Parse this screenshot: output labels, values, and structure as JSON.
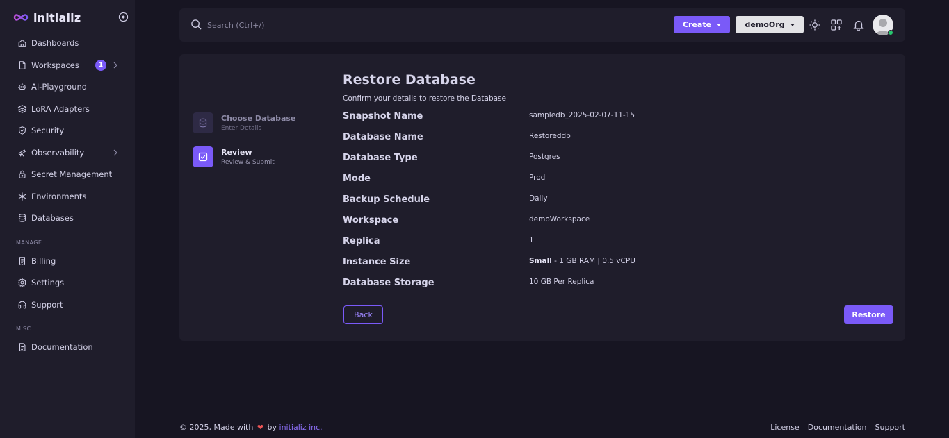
{
  "brand": {
    "name": "initializ"
  },
  "sidebar": {
    "items": [
      {
        "label": "Dashboards",
        "icon": "home-icon"
      },
      {
        "label": "Workspaces",
        "icon": "file-icon",
        "badge": "1"
      },
      {
        "label": "AI-Playground",
        "icon": "robot-icon"
      },
      {
        "label": "LoRA Adapters",
        "icon": "layers-icon"
      },
      {
        "label": "Security",
        "icon": "shield-icon"
      },
      {
        "label": "Observability",
        "icon": "telescope-icon"
      },
      {
        "label": "Secret Management",
        "icon": "lock-icon"
      },
      {
        "label": "Environments",
        "icon": "snowflake-icon"
      },
      {
        "label": "Databases",
        "icon": "database-icon"
      }
    ],
    "manage_label": "MANAGE",
    "manage_items": [
      {
        "label": "Billing",
        "icon": "receipt-icon"
      },
      {
        "label": "Settings",
        "icon": "gear-icon"
      },
      {
        "label": "Support",
        "icon": "headphones-icon"
      }
    ],
    "misc_label": "MISC",
    "misc_items": [
      {
        "label": "Documentation",
        "icon": "document-icon"
      }
    ]
  },
  "header": {
    "search_placeholder": "Search (Ctrl+/)",
    "create_label": "Create",
    "org_label": "demoOrg"
  },
  "stepper": {
    "steps": [
      {
        "title": "Choose Database",
        "subtitle": "Enter Details"
      },
      {
        "title": "Review",
        "subtitle": "Review & Submit"
      }
    ]
  },
  "review": {
    "title": "Restore Database",
    "subtitle": "Confirm your details to restore the Database",
    "rows": [
      {
        "label": "Snapshot Name",
        "value": "sampledb_2025-02-07-11-15"
      },
      {
        "label": "Database Name",
        "value": "Restoreddb"
      },
      {
        "label": "Database Type",
        "value": "Postgres"
      },
      {
        "label": "Mode",
        "value": "Prod"
      },
      {
        "label": "Backup Schedule",
        "value": "Daily"
      },
      {
        "label": "Workspace",
        "value": "demoWorkspace"
      },
      {
        "label": "Replica",
        "value": "1"
      },
      {
        "label": "Instance Size",
        "value_bold": "Small",
        "value": " - 1 GB RAM | 0.5 vCPU"
      },
      {
        "label": "Database Storage",
        "value": "10 GB Per Replica"
      }
    ],
    "back_label": "Back",
    "restore_label": "Restore"
  },
  "footer": {
    "prefix": "© 2025, Made with",
    "by": "by",
    "company": "initializ inc.",
    "links": [
      "License",
      "Documentation",
      "Support"
    ]
  },
  "colors": {
    "accent": "#7a5af8",
    "background": "#171522",
    "panel": "#1f1d2b"
  }
}
